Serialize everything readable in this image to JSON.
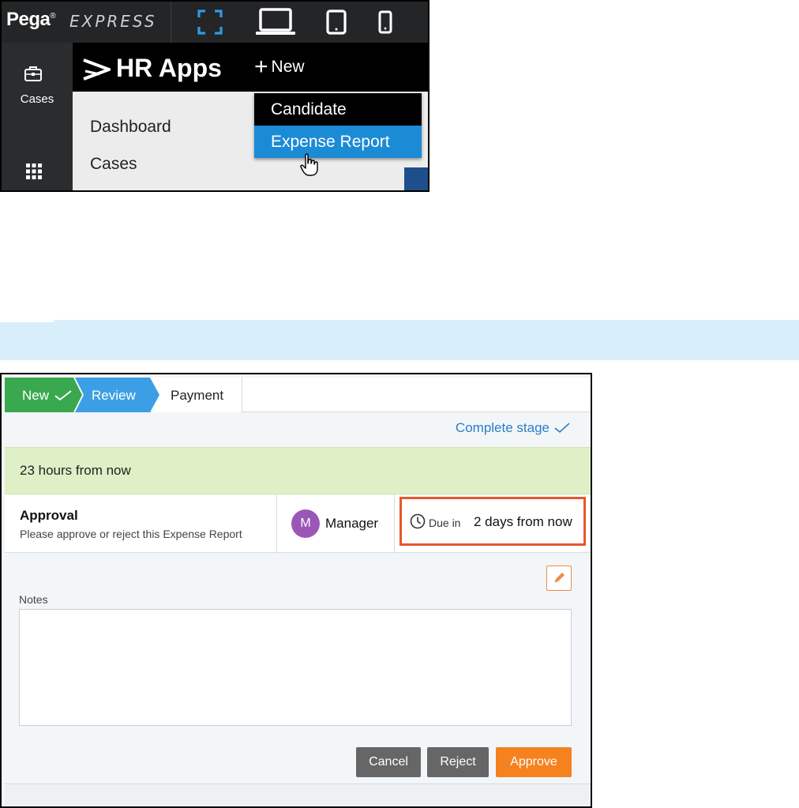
{
  "pega_app": {
    "logo_text": "Pega",
    "logo_mark": "®",
    "product": "EXPRESS",
    "device_icons": [
      "fullscreen-icon",
      "laptop-icon",
      "tablet-icon",
      "phone-icon"
    ],
    "sidebar": {
      "cases_label": "Cases"
    },
    "app_title": "HR Apps",
    "new_label": "New",
    "nav": {
      "dashboard": "Dashboard",
      "cases": "Cases"
    },
    "new_menu": {
      "items": [
        "Candidate",
        "Expense Report"
      ],
      "highlighted": "Expense Report"
    },
    "colors": {
      "menu_highlight": "#1b8bd6",
      "header": "#000000"
    }
  },
  "case": {
    "stages": [
      {
        "label": "New",
        "status": "complete",
        "color": "#3aa84f"
      },
      {
        "label": "Review",
        "status": "current",
        "color": "#3c9fe6"
      },
      {
        "label": "Payment",
        "status": "future",
        "color": "#ffffff"
      }
    ],
    "complete_stage_label": "Complete stage",
    "sla_text": "23 hours from now",
    "assignment": {
      "title": "Approval",
      "description": "Please approve or reject this Expense Report",
      "avatar_initial": "M",
      "assignee": "Manager",
      "due_label": "Due in",
      "due_value": "2 days from now"
    },
    "notes_label": "Notes",
    "notes_value": "",
    "buttons": {
      "cancel": "Cancel",
      "reject": "Reject",
      "approve": "Approve"
    },
    "colors": {
      "approve": "#f5821f",
      "highlight_border": "#e8562a",
      "sla_bg": "#dff0c7"
    }
  }
}
